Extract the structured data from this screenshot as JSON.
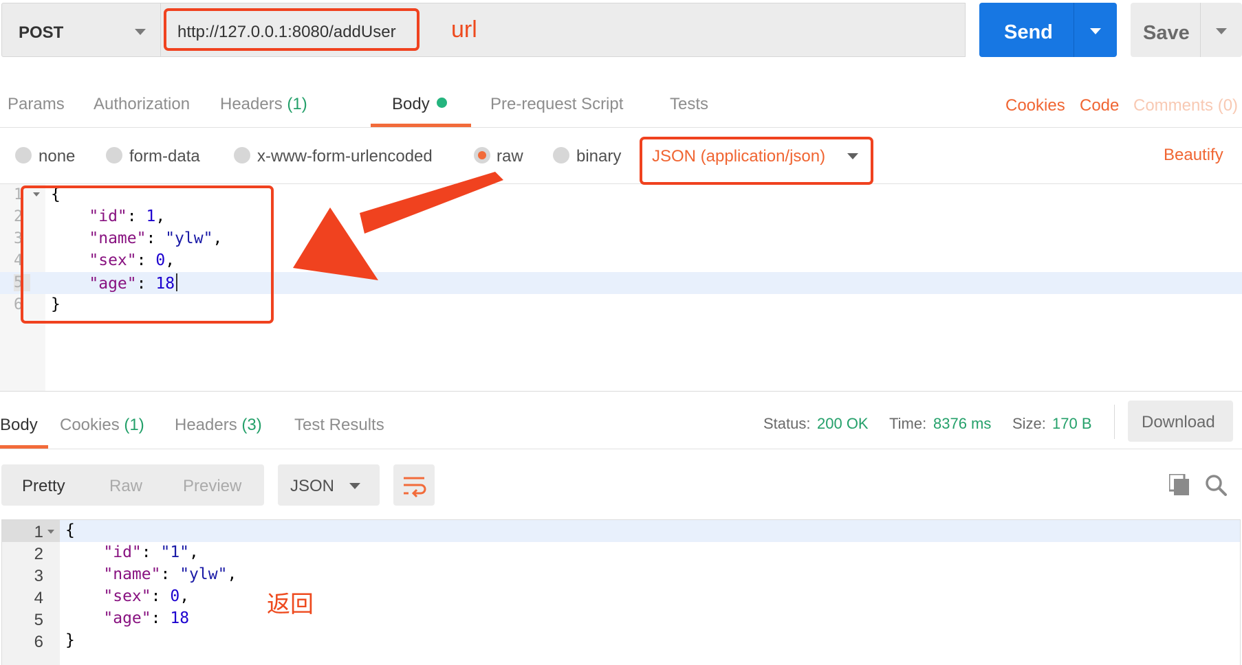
{
  "request": {
    "method": "POST",
    "url": "http://127.0.0.1:8080/addUser",
    "send_label": "Send",
    "save_label": "Save"
  },
  "annotations": {
    "url_note": "url",
    "response_note": "返回"
  },
  "request_tabs": {
    "params": "Params",
    "authorization": "Authorization",
    "headers": "Headers",
    "headers_count": "(1)",
    "body": "Body",
    "pre_request": "Pre-request Script",
    "tests": "Tests",
    "cookies": "Cookies",
    "code": "Code",
    "comments": "Comments (0)"
  },
  "body_types": {
    "none": "none",
    "form_data": "form-data",
    "urlencoded": "x-www-form-urlencoded",
    "raw": "raw",
    "binary": "binary",
    "selected": "raw",
    "content_type": "JSON (application/json)",
    "beautify": "Beautify"
  },
  "request_body": {
    "line_numbers": [
      "1",
      "2",
      "3",
      "4",
      "5",
      "6"
    ],
    "lines": [
      "{",
      "\"id\": 1,",
      "\"name\": \"ylw\",",
      "\"sex\": 0,",
      "\"age\": 18",
      "}"
    ],
    "fields": {
      "id_key": "\"id\"",
      "id_val": "1",
      "name_key": "\"name\"",
      "name_val": "\"ylw\"",
      "sex_key": "\"sex\"",
      "sex_val": "0",
      "age_key": "\"age\"",
      "age_val": "18"
    },
    "highlighted_line": 5
  },
  "response_tabs": {
    "body": "Body",
    "cookies": "Cookies",
    "cookies_count": "(1)",
    "headers": "Headers",
    "headers_count": "(3)",
    "test_results": "Test Results"
  },
  "response_meta": {
    "status_label": "Status:",
    "status_value": "200 OK",
    "time_label": "Time:",
    "time_value": "8376 ms",
    "size_label": "Size:",
    "size_value": "170 B",
    "download_label": "Download"
  },
  "response_toolbar": {
    "pretty": "Pretty",
    "raw": "Raw",
    "preview": "Preview",
    "format": "JSON",
    "active_view": "Pretty"
  },
  "response_body": {
    "line_numbers": [
      "1",
      "2",
      "3",
      "4",
      "5",
      "6"
    ],
    "lines": [
      "{",
      "\"id\": \"1\",",
      "\"name\": \"ylw\",",
      "\"sex\": 0,",
      "\"age\": 18",
      "}"
    ],
    "fields": {
      "id_key": "\"id\"",
      "id_val": "\"1\"",
      "name_key": "\"name\"",
      "name_val": "\"ylw\"",
      "sex_key": "\"sex\"",
      "sex_val": "0",
      "age_key": "\"age\"",
      "age_val": "18"
    },
    "highlighted_line": 1
  },
  "icons": {
    "copy": "copy-icon",
    "search": "search-icon",
    "wrap": "wrap-lines-icon",
    "arrow": "annotation-arrow"
  },
  "colors": {
    "accent_orange": "#f26b3a",
    "send_blue": "#1777e3",
    "status_green": "#24a06a",
    "annotation_red": "#f0421f"
  }
}
